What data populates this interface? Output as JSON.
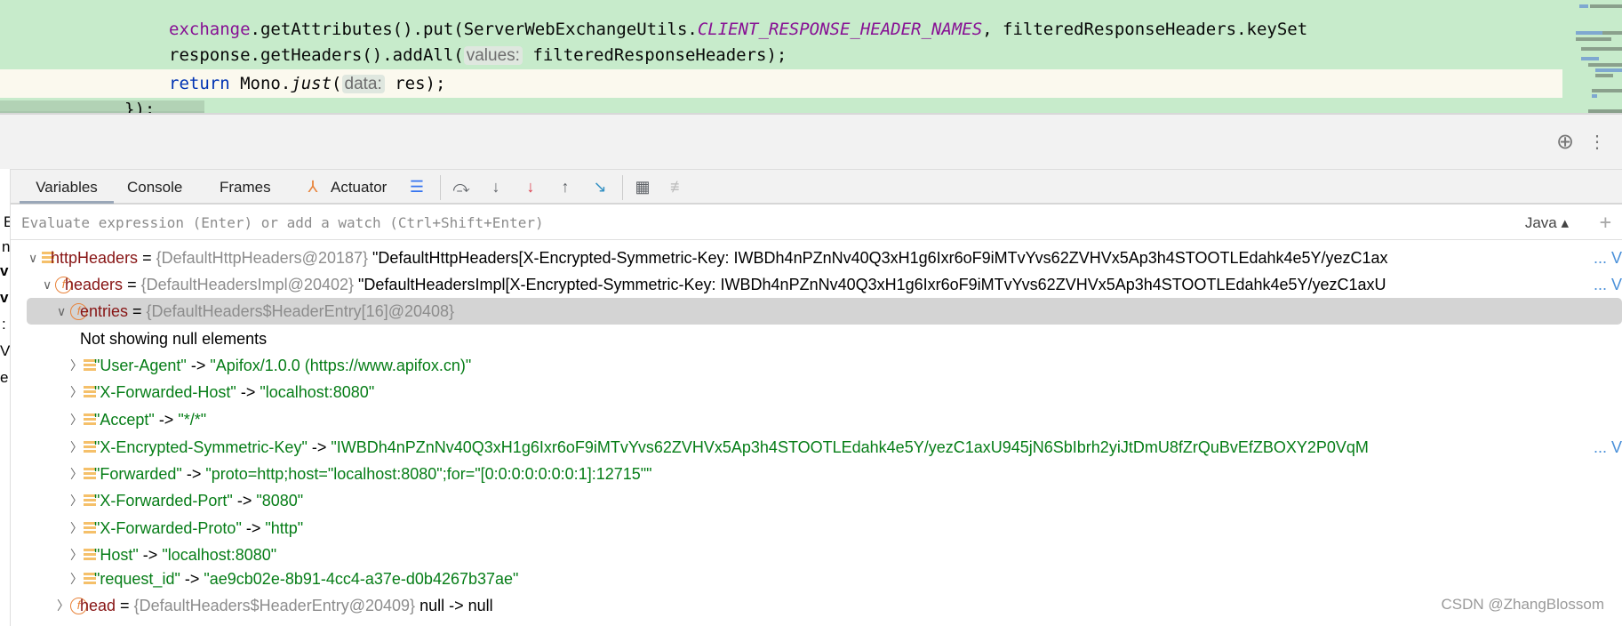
{
  "editor": {
    "line1": {
      "obj": "exchange",
      "a": ".getAttributes().put(ServerWebExchangeUtils.",
      "const": "CLIENT_RESPONSE_HEADER_NAMES",
      "b": ", filteredResponseHeaders.keySet"
    },
    "line2": {
      "a": "response.getHeaders().addAll(",
      "hint": "values:",
      "b": " filteredResponseHeaders);"
    },
    "line3": {
      "kw": "return",
      "a": " Mono.",
      "method": "just",
      "b": "(",
      "hint": "data:",
      "c": " res);"
    },
    "line4": "});"
  },
  "toolbar": {
    "tabs": [
      {
        "label": "Variables",
        "active": true
      },
      {
        "label": "Console"
      },
      {
        "label": "Frames"
      },
      {
        "label": "Actuator",
        "icon": "actuator-icon"
      }
    ],
    "icons": [
      "list-icon",
      "step-over-icon",
      "step-into-icon",
      "force-step-into-icon",
      "step-out-icon",
      "run-to-cursor-icon",
      "evaluate-icon",
      "trace-off-icon"
    ],
    "right_icons": [
      "target-icon",
      "more-icon"
    ]
  },
  "evaluate": {
    "placeholder": "Evaluate expression (Enter) or add a watch (Ctrl+Shift+Enter)",
    "language": "Java"
  },
  "left_fragments": [
    "E",
    "n",
    "v",
    "v",
    ":",
    "V",
    "e"
  ],
  "tree": [
    {
      "name": "httpHeaders",
      "type": "{DefaultHttpHeaders@20187}",
      "value": "\"DefaultHttpHeaders[X-Encrypted-Symmetric-Key: IWBDh4nPZnNv40Q3xH1g6Ixr6oF9iMTvYvs62ZVHVx5Ap3h4STOOTLEdahk4e5Y/yezC1ax",
      "more": "... V"
    },
    {
      "name": "headers",
      "type": "{DefaultHeadersImpl@20402}",
      "value": "\"DefaultHeadersImpl[X-Encrypted-Symmetric-Key: IWBDh4nPZnNv40Q3xH1g6Ixr6oF9iMTvYvs62ZVHVx5Ap3h4STOOTLEdahk4e5Y/yezC1axU",
      "more": "... V"
    },
    {
      "name": "entries",
      "type": "{DefaultHeaders$HeaderEntry[16]@20408}"
    },
    {
      "note": "Not showing null elements"
    },
    {
      "key": "\"User-Agent\"",
      "val": "\"Apifox/1.0.0 (https://www.apifox.cn)\""
    },
    {
      "key": "\"X-Forwarded-Host\"",
      "val": "\"localhost:8080\""
    },
    {
      "key": "\"Accept\"",
      "val": "\"*/*\""
    },
    {
      "key": "\"X-Encrypted-Symmetric-Key\"",
      "val": "\"IWBDh4nPZnNv40Q3xH1g6Ixr6oF9iMTvYvs62ZVHVx5Ap3h4STOOTLEdahk4e5Y/yezC1axU945jN6SbIbrh2yiJtDmU8fZrQuBvEfZBOXY2P0VqM",
      "more": "... V"
    },
    {
      "key": "\"Forwarded\"",
      "val": "\"proto=http;host=\"localhost:8080\";for=\"[0:0:0:0:0:0:0:1]:12715\"\""
    },
    {
      "key": "\"X-Forwarded-Port\"",
      "val": "\"8080\""
    },
    {
      "key": "\"X-Forwarded-Proto\"",
      "val": "\"http\""
    },
    {
      "key": "\"Host\"",
      "val": "\"localhost:8080\""
    },
    {
      "key": "\"request_id\"",
      "val": "\"ae9cb02e-8b91-4cc4-a37e-d0b4267b37ae\""
    },
    {
      "name": "head",
      "type": "{DefaultHeaders$HeaderEntry@20409}",
      "value": "null -> null"
    }
  ],
  "arrow": " -> ",
  "eq": " = ",
  "watermark": "CSDN @ZhangBlossom"
}
